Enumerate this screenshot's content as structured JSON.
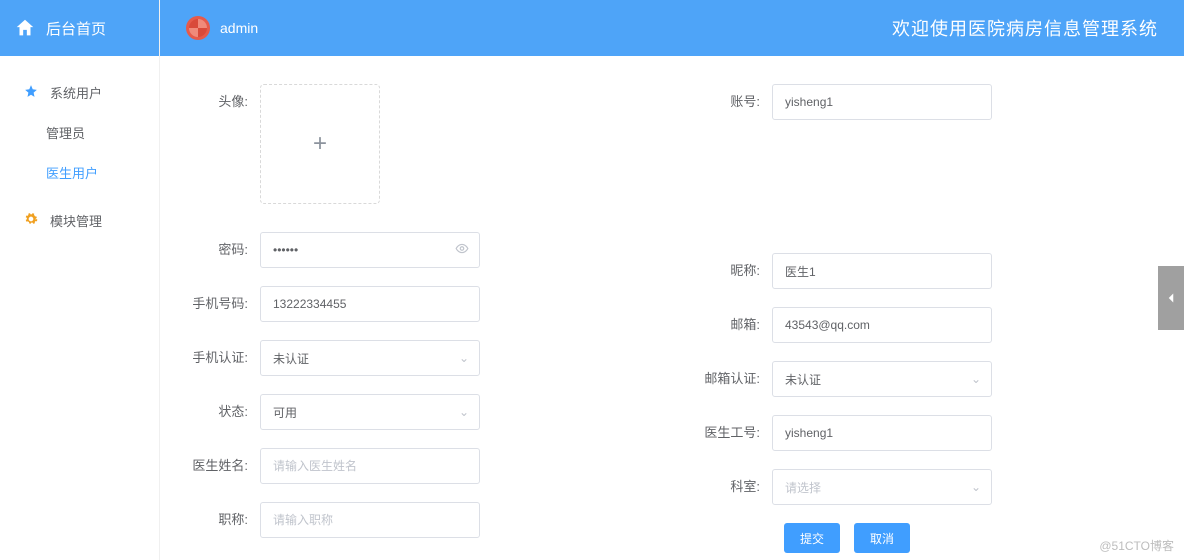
{
  "sidebar": {
    "home": "后台首页",
    "nav": {
      "system_users": "系统用户",
      "admin": "管理员",
      "doctor_users": "医生用户",
      "module_mgmt": "模块管理"
    }
  },
  "topbar": {
    "user": "admin",
    "title": "欢迎使用医院病房信息管理系统"
  },
  "form": {
    "avatar_label": "头像:",
    "account": {
      "label": "账号:",
      "value": "yisheng1"
    },
    "password": {
      "label": "密码:",
      "value": "••••••"
    },
    "nickname": {
      "label": "昵称:",
      "value": "医生1"
    },
    "phone": {
      "label": "手机号码:",
      "value": "13222334455"
    },
    "email": {
      "label": "邮箱:",
      "value": "43543@qq.com"
    },
    "phone_auth": {
      "label": "手机认证:",
      "value": "未认证"
    },
    "email_auth": {
      "label": "邮箱认证:",
      "value": "未认证"
    },
    "status": {
      "label": "状态:",
      "value": "可用"
    },
    "doctor_no": {
      "label": "医生工号:",
      "value": "yisheng1"
    },
    "doctor_name": {
      "label": "医生姓名:",
      "placeholder": "请输入医生姓名"
    },
    "dept": {
      "label": "科室:",
      "placeholder": "请选择"
    },
    "title": {
      "label": "职称:",
      "placeholder": "请输入职称"
    }
  },
  "buttons": {
    "submit": "提交",
    "cancel": "取消"
  },
  "watermark": "@51CTO博客"
}
